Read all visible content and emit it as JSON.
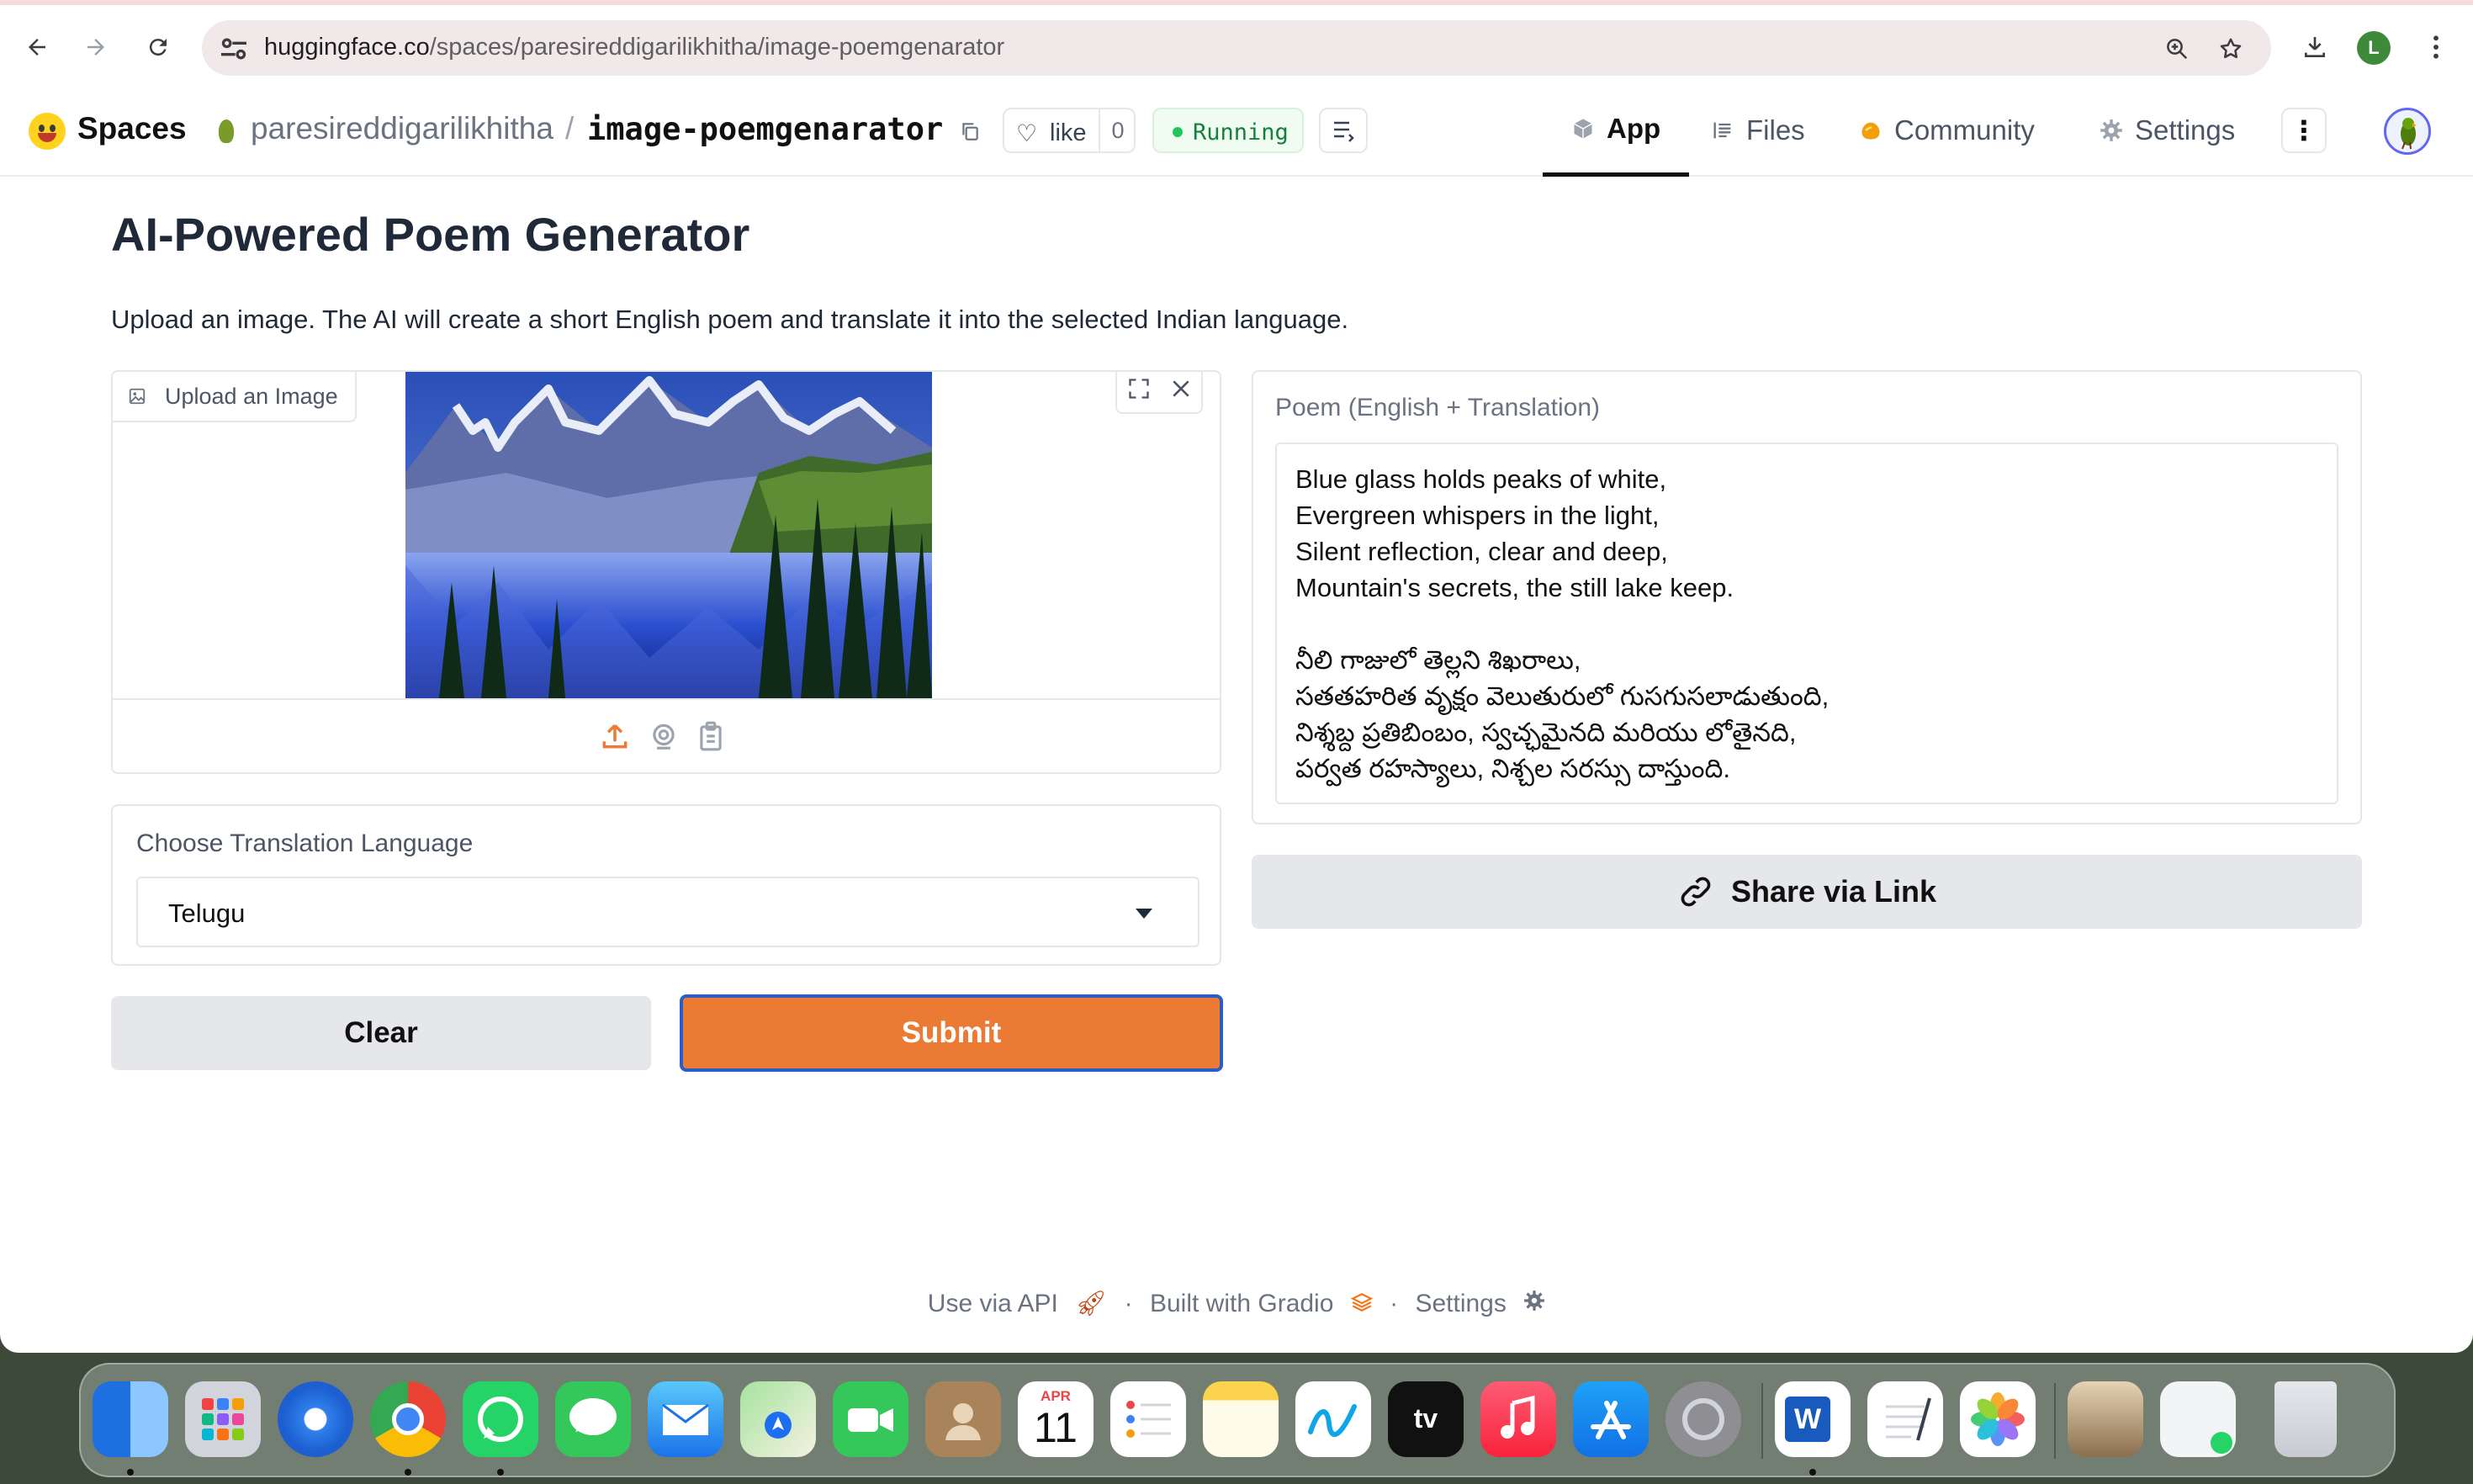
{
  "browser": {
    "url_host": "huggingface.co",
    "url_path": "/spaces/paresireddigarilikhitha/image-poemgenarator",
    "profile_initial": "L"
  },
  "hf": {
    "brand": "Spaces",
    "owner": "paresireddigarilikhitha",
    "separator": "/",
    "space_name": "image-poemgenarator",
    "like_label": "like",
    "like_count": "0",
    "status": "Running",
    "tabs": [
      {
        "label": "App",
        "icon": "cube-icon"
      },
      {
        "label": "Files",
        "icon": "files-icon"
      },
      {
        "label": "Community",
        "icon": "community-icon"
      },
      {
        "label": "Settings",
        "icon": "gear-icon"
      }
    ]
  },
  "app": {
    "title": "AI-Powered Poem Generator",
    "description": "Upload an image. The AI will create a short English poem and translate it into the selected Indian language.",
    "image_label": "Upload an Image",
    "language_label": "Choose Translation Language",
    "language_value": "Telugu",
    "clear_label": "Clear",
    "submit_label": "Submit",
    "poem_label": "Poem (English + Translation)",
    "poem_english": [
      "Blue glass holds peaks of white,",
      "Evergreen whispers in the light,",
      "Silent reflection, clear and deep,",
      "Mountain's secrets, the still lake keep."
    ],
    "poem_translation": [
      "నీలి గాజులో తెల్లని శిఖరాలు,",
      "సతతహరిత వృక్షం వెలుతురులో గుసగుసలాడుతుంది,",
      "నిశ్శబ్ద ప్రతిబింబం, స్వచ్ఛమైనది మరియు లోతైనది,",
      "పర్వత రహస్యాలు, నిశ్చల సరస్సు దాస్తుంది."
    ],
    "share_label": "Share via Link"
  },
  "footer": {
    "api": "Use via API",
    "sep": "·",
    "built": "Built with Gradio",
    "settings": "Settings"
  },
  "dock": {
    "calendar_month": "APR",
    "calendar_day": "11"
  },
  "colors": {
    "accent_orange": "#eb7a34",
    "focus_blue": "#2b5dc7",
    "running_green": "#22c55e"
  }
}
